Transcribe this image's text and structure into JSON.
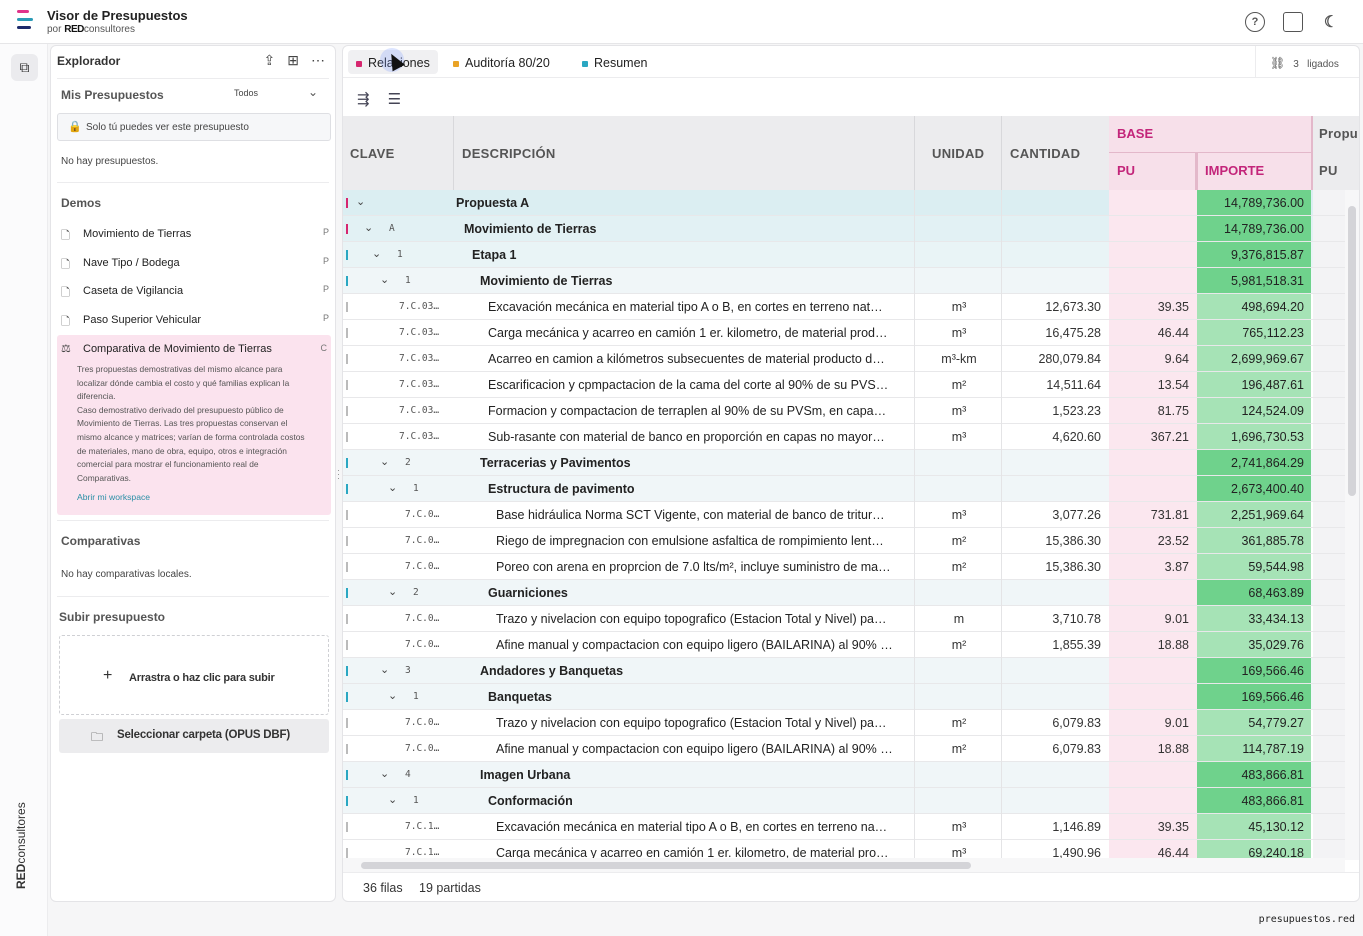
{
  "app": {
    "title": "Visor de Presupuestos",
    "by_prefix": "por",
    "by_brand_bold": "RED",
    "by_brand_rest": "consultores",
    "logo_colors": [
      "#e0338a",
      "#2a9bb6",
      "#1d2a6b"
    ],
    "top_icons": [
      "help-icon",
      "chat-icon",
      "moon-icon"
    ]
  },
  "rail": {
    "brand_bold": "RED",
    "brand_rest": "consultores",
    "button_icon": "copy-icon"
  },
  "sidebar": {
    "header": "Explorador",
    "header_icons": [
      "upload-icon",
      "new-folder-icon",
      "more-icon"
    ],
    "mis": {
      "title": "Mis Presupuestos",
      "filter_value": "Todos",
      "privacy_note": "Solo tú puedes ver este presupuesto",
      "empty": "No hay presupuestos."
    },
    "demos": {
      "title": "Demos",
      "items": [
        {
          "label": "Movimiento de Tierras",
          "tag": "P"
        },
        {
          "label": "Nave Tipo / Bodega",
          "tag": "P"
        },
        {
          "label": "Caseta de Vigilancia",
          "tag": "P"
        },
        {
          "label": "Paso Superior Vehicular",
          "tag": "P"
        }
      ],
      "active": {
        "label": "Comparativa de Movimiento de Tierras",
        "tag": "C",
        "desc1": "Tres propuestas demostrativas del mismo alcance para localizar dónde cambia el costo y qué familias explican la diferencia.",
        "desc2": "Caso demostrativo derivado del presupuesto público de Movimiento de Tierras. Las tres propuestas conservan el mismo alcance y matrices; varían de forma controlada costos de materiales, mano de obra, equipo, otros e integración comercial para mostrar el funcionamiento real de Comparativas.",
        "link": "Abrir mi workspace"
      }
    },
    "comparativas": {
      "title": "Comparativas",
      "empty": "No hay comparativas locales."
    },
    "upload": {
      "title": "Subir presupuesto",
      "drop_label": "Arrastra o haz clic para subir",
      "folder_label": "Seleccionar carpeta (OPUS DBF)"
    }
  },
  "tabs": [
    {
      "label": "Relaciones",
      "color": "#d6266f"
    },
    {
      "label": "Auditoría 80/20",
      "color": "#e9a326"
    },
    {
      "label": "Resumen",
      "color": "#2aa7c2"
    }
  ],
  "linked": {
    "count": "3",
    "label": "ligados"
  },
  "toolbar_icons": [
    "wrap-text-icon",
    "filter-icon"
  ],
  "columns": {
    "clave": "CLAVE",
    "descripcion": "DESCRIPCIÓN",
    "unidad": "UNIDAD",
    "cantidad": "CANTIDAD",
    "base": "BASE",
    "pu": "PU",
    "importe": "IMPORTE",
    "next_group": "Propu",
    "next_pu": "PU"
  },
  "rows": [
    {
      "level": 0,
      "group": true,
      "markColor": "#d6266f",
      "code": "",
      "desc": "Propuesta A",
      "unit": "",
      "qty": "",
      "pu": "",
      "imp": "14,789,736.00"
    },
    {
      "level": 1,
      "group": true,
      "markColor": "#d6266f",
      "code": "A",
      "desc": "Movimiento de Tierras",
      "unit": "",
      "qty": "",
      "pu": "",
      "imp": "14,789,736.00"
    },
    {
      "level": 2,
      "group": true,
      "markColor": "#2aa7c2",
      "code": "1",
      "desc": "Etapa 1",
      "unit": "",
      "qty": "",
      "pu": "",
      "imp": "9,376,815.87"
    },
    {
      "level": 3,
      "group": true,
      "markColor": "#2aa7c2",
      "code": "1",
      "desc": "Movimiento de Tierras",
      "unit": "",
      "qty": "",
      "pu": "",
      "imp": "5,981,518.31"
    },
    {
      "level": 4,
      "group": false,
      "code": "7.C.03…",
      "desc": "Excavación mecánica en material tipo A o B, en cortes en terreno nat…",
      "unit": "m³",
      "qty": "12,673.30",
      "pu": "39.35",
      "imp": "498,694.20"
    },
    {
      "level": 4,
      "group": false,
      "code": "7.C.03…",
      "desc": "Carga mecánica y acarreo en camión 1 er. kilometro, de material prod…",
      "unit": "m³",
      "qty": "16,475.28",
      "pu": "46.44",
      "imp": "765,112.23"
    },
    {
      "level": 4,
      "group": false,
      "code": "7.C.03…",
      "desc": "Acarreo en camion a kilómetros subsecuentes de material producto d…",
      "unit": "m³-km",
      "qty": "280,079.84",
      "pu": "9.64",
      "imp": "2,699,969.67"
    },
    {
      "level": 4,
      "group": false,
      "code": "7.C.03…",
      "desc": "Escarificacion y cpmpactacion de la cama del corte al 90% de su PVS…",
      "unit": "m²",
      "qty": "14,511.64",
      "pu": "13.54",
      "imp": "196,487.61"
    },
    {
      "level": 4,
      "group": false,
      "code": "7.C.03…",
      "desc": "Formacion y compactacion de terraplen al 90% de su PVSm, en capa…",
      "unit": "m³",
      "qty": "1,523.23",
      "pu": "81.75",
      "imp": "124,524.09"
    },
    {
      "level": 4,
      "group": false,
      "code": "7.C.03…",
      "desc": "Sub-rasante con material de banco en proporción en capas no mayor…",
      "unit": "m³",
      "qty": "4,620.60",
      "pu": "367.21",
      "imp": "1,696,730.53"
    },
    {
      "level": 3,
      "group": true,
      "markColor": "#2aa7c2",
      "code": "2",
      "desc": "Terracerias y Pavimentos",
      "unit": "",
      "qty": "",
      "pu": "",
      "imp": "2,741,864.29"
    },
    {
      "level": 4,
      "group": true,
      "markColor": "#2aa7c2",
      "code": "1",
      "desc": "Estructura de pavimento",
      "unit": "",
      "qty": "",
      "pu": "",
      "imp": "2,673,400.40"
    },
    {
      "level": 5,
      "group": false,
      "code": "7.C.0…",
      "desc": "Base hidráulica Norma SCT Vigente, con material de banco de tritur…",
      "unit": "m³",
      "qty": "3,077.26",
      "pu": "731.81",
      "imp": "2,251,969.64"
    },
    {
      "level": 5,
      "group": false,
      "code": "7.C.0…",
      "desc": "Riego de impregnacion con emulsione asfaltica de rompimiento lent…",
      "unit": "m²",
      "qty": "15,386.30",
      "pu": "23.52",
      "imp": "361,885.78"
    },
    {
      "level": 5,
      "group": false,
      "code": "7.C.0…",
      "desc": "Poreo con arena en proprcion de 7.0 lts/m², incluye suministro de ma…",
      "unit": "m²",
      "qty": "15,386.30",
      "pu": "3.87",
      "imp": "59,544.98"
    },
    {
      "level": 4,
      "group": true,
      "markColor": "#2aa7c2",
      "code": "2",
      "desc": "Guarniciones",
      "unit": "",
      "qty": "",
      "pu": "",
      "imp": "68,463.89"
    },
    {
      "level": 5,
      "group": false,
      "code": "7.C.0…",
      "desc": "Trazo y nivelacion con equipo topografico (Estacion Total y Nivel) pa…",
      "unit": "m",
      "qty": "3,710.78",
      "pu": "9.01",
      "imp": "33,434.13"
    },
    {
      "level": 5,
      "group": false,
      "code": "7.C.0…",
      "desc": "Afine manual y compactacion con equipo ligero (BAILARINA) al 90% …",
      "unit": "m²",
      "qty": "1,855.39",
      "pu": "18.88",
      "imp": "35,029.76"
    },
    {
      "level": 3,
      "group": true,
      "markColor": "#2aa7c2",
      "code": "3",
      "desc": "Andadores y Banquetas",
      "unit": "",
      "qty": "",
      "pu": "",
      "imp": "169,566.46"
    },
    {
      "level": 4,
      "group": true,
      "markColor": "#2aa7c2",
      "code": "1",
      "desc": "Banquetas",
      "unit": "",
      "qty": "",
      "pu": "",
      "imp": "169,566.46"
    },
    {
      "level": 5,
      "group": false,
      "code": "7.C.0…",
      "desc": "Trazo y nivelacion con equipo topografico (Estacion Total y Nivel) pa…",
      "unit": "m²",
      "qty": "6,079.83",
      "pu": "9.01",
      "imp": "54,779.27"
    },
    {
      "level": 5,
      "group": false,
      "code": "7.C.0…",
      "desc": "Afine manual y compactacion con equipo ligero (BAILARINA) al 90% …",
      "unit": "m²",
      "qty": "6,079.83",
      "pu": "18.88",
      "imp": "114,787.19"
    },
    {
      "level": 3,
      "group": true,
      "markColor": "#2aa7c2",
      "code": "4",
      "desc": "Imagen Urbana",
      "unit": "",
      "qty": "",
      "pu": "",
      "imp": "483,866.81"
    },
    {
      "level": 4,
      "group": true,
      "markColor": "#2aa7c2",
      "code": "1",
      "desc": "Conformación",
      "unit": "",
      "qty": "",
      "pu": "",
      "imp": "483,866.81"
    },
    {
      "level": 5,
      "group": false,
      "code": "7.C.1…",
      "desc": "Excavación mecánica en material tipo A o B, en cortes en terreno na…",
      "unit": "m³",
      "qty": "1,146.89",
      "pu": "39.35",
      "imp": "45,130.12"
    },
    {
      "level": 5,
      "group": false,
      "code": "7.C.1…",
      "desc": "Carga mecánica y acarreo en camión 1 er. kilometro, de material pro…",
      "unit": "m³",
      "qty": "1,490.96",
      "pu": "46.44",
      "imp": "69,240.18"
    }
  ],
  "footer": {
    "rows": "36 filas",
    "items": "19 partidas"
  },
  "domain": "presupuestos.red"
}
